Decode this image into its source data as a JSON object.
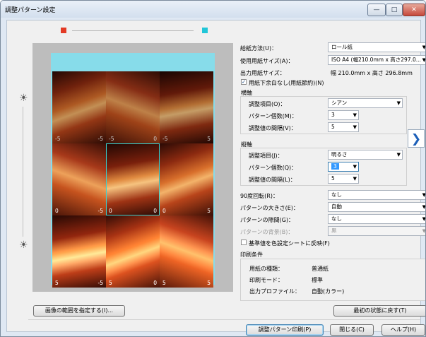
{
  "window": {
    "title": "調整パターン設定",
    "minimize": "—",
    "maximize": "□",
    "close": "✕"
  },
  "colors": {
    "red_marker": "#e33a24",
    "cyan_marker": "#21c6d8",
    "accent": "#3c7fb1",
    "cyan_frame": "#37d3d3"
  },
  "preview": {
    "rows": [
      [
        "-5",
        "-5",
        "-5",
        "0",
        "-5",
        "5"
      ],
      [
        "0",
        "-5",
        "0",
        "0",
        "0",
        "5"
      ],
      [
        "5",
        "-5",
        "5",
        "0",
        "5",
        "5"
      ]
    ],
    "vertical_slider_icon_top": "☀",
    "vertical_slider_icon_bottom": "☀",
    "specify_range_button": "画像の範囲を指定する(I)..."
  },
  "fields": {
    "feed_method": {
      "label": "給紙方法(U)：",
      "value": "ロール紙"
    },
    "paper_size": {
      "label": "使用用紙サイズ(A)：",
      "value": "ISO A4 (幅210.0mm x 高さ297.0..."
    },
    "output_size": {
      "label": "出力用紙サイズ：",
      "value": "幅 210.0mm x 高さ 296.8mm"
    },
    "no_margin": {
      "label": "用紙下余白なし(用紙節約)(N)",
      "checked": "✓"
    }
  },
  "horizontal": {
    "title": "横軸",
    "item": {
      "label": "調整項目(O)：",
      "value": "シアン"
    },
    "count": {
      "label": "パターン個数(M)：",
      "value": "3"
    },
    "interval": {
      "label": "調整値の間隔(V)：",
      "value": "5"
    }
  },
  "vertical": {
    "title": "縦軸",
    "item": {
      "label": "調整項目(J)：",
      "value": "明るさ"
    },
    "count": {
      "label": "パターン個数(Q)：",
      "value": "3"
    },
    "interval": {
      "label": "調整値の間隔(L)：",
      "value": "5"
    }
  },
  "swap_icon": "❯",
  "options": {
    "rotate": {
      "label": "90度回転(R)：",
      "value": "なし"
    },
    "pattern_size": {
      "label": "パターンの大きさ(E)：",
      "value": "自動"
    },
    "pattern_gap": {
      "label": "パターンの隙間(G)：",
      "value": "なし"
    },
    "pattern_bg": {
      "label": "パターンの背景(B)：",
      "value": "黒"
    },
    "reflect": {
      "label": "基準値を色設定シートに反映(F)"
    }
  },
  "print_conditions": {
    "title": "印刷条件",
    "paper_type": {
      "label": "用紙の種類：",
      "value": "普通紙"
    },
    "print_mode": {
      "label": "印刷モード：",
      "value": "標準"
    },
    "output_profile": {
      "label": "出力プロファイル：",
      "value": "自動(カラー)"
    }
  },
  "buttons": {
    "reset": "最初の状態に戻す(T)",
    "print": "調整パターン印刷(P)",
    "close": "閉じる(C)",
    "help": "ヘルプ(H)"
  },
  "dropdown_arrow": "▼"
}
